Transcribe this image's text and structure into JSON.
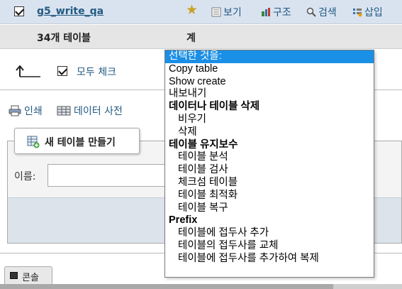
{
  "table_row": {
    "name": "g5_write_qa",
    "actions": [
      {
        "icon": "browse-icon",
        "label": "보기"
      },
      {
        "icon": "structure-icon",
        "label": "구조"
      },
      {
        "icon": "search-icon",
        "label": "검색"
      },
      {
        "icon": "insert-icon",
        "label": "삽입"
      }
    ]
  },
  "summary": {
    "count": "34개 테이블",
    "total": "계"
  },
  "bulk": {
    "check_all": "모두 체크",
    "dropdown": {
      "selected": "선택한 것을:",
      "items": [
        {
          "label": "Copy table",
          "kind": "item"
        },
        {
          "label": "Show create",
          "kind": "item"
        },
        {
          "label": "내보내기",
          "kind": "item"
        },
        {
          "label": "데이터나 테이블 삭제",
          "kind": "group"
        },
        {
          "label": "비우기",
          "kind": "sub"
        },
        {
          "label": "삭제",
          "kind": "sub"
        },
        {
          "label": "테이블 유지보수",
          "kind": "group"
        },
        {
          "label": "테이블 분석",
          "kind": "sub"
        },
        {
          "label": "테이블 검사",
          "kind": "sub"
        },
        {
          "label": "체크섬 테이블",
          "kind": "sub"
        },
        {
          "label": "테이블 최적화",
          "kind": "sub"
        },
        {
          "label": "테이블 복구",
          "kind": "sub"
        },
        {
          "label": "Prefix",
          "kind": "group"
        },
        {
          "label": "테이블에 접두사 추가",
          "kind": "sub"
        },
        {
          "label": "테이블의 접두사를 교체",
          "kind": "sub"
        },
        {
          "label": "테이블에 접두사를 추가하여 복제",
          "kind": "sub"
        }
      ]
    }
  },
  "links": {
    "print": "인쇄",
    "data_dictionary": "데이터 사전"
  },
  "create_table": {
    "legend": "새 테이블 만들기",
    "name_label": "이름:"
  },
  "console": {
    "label": "콘솔"
  }
}
